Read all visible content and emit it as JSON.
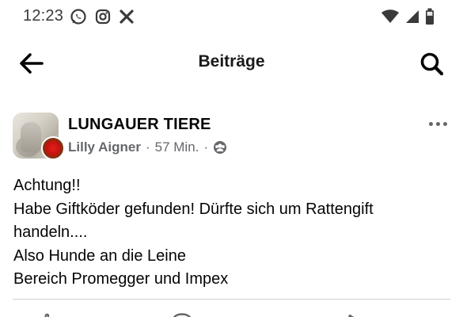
{
  "status_bar": {
    "time": "12:23",
    "left_icons": [
      "whatsapp-icon",
      "instagram-icon",
      "x-icon"
    ],
    "right_icons": [
      "wifi-icon",
      "signal-icon",
      "battery-icon"
    ]
  },
  "header": {
    "title": "Beiträge",
    "back_icon": "arrow-left-icon",
    "search_icon": "search-icon"
  },
  "post": {
    "group_name": "LUNGAUER TIERE",
    "author": "Lilly Aigner",
    "separator": "·",
    "time_ago": "57 Min.",
    "audience_icon": "group-audience-icon",
    "menu_icon": "more-horizontal-icon",
    "body_lines": [
      "Achtung!!",
      "Habe Giftköder gefunden! Dürfte sich um Rattengift",
      "handeln....",
      "Also Hunde an die Leine",
      "Bereich Promegger und Impex"
    ]
  },
  "actions": {
    "icons": [
      "like-icon",
      "comment-icon",
      "share-icon"
    ]
  },
  "colors": {
    "text_primary": "#050505",
    "text_secondary": "#65676b",
    "divider": "#ced0d4",
    "status_icons": "#3a3a3a"
  }
}
